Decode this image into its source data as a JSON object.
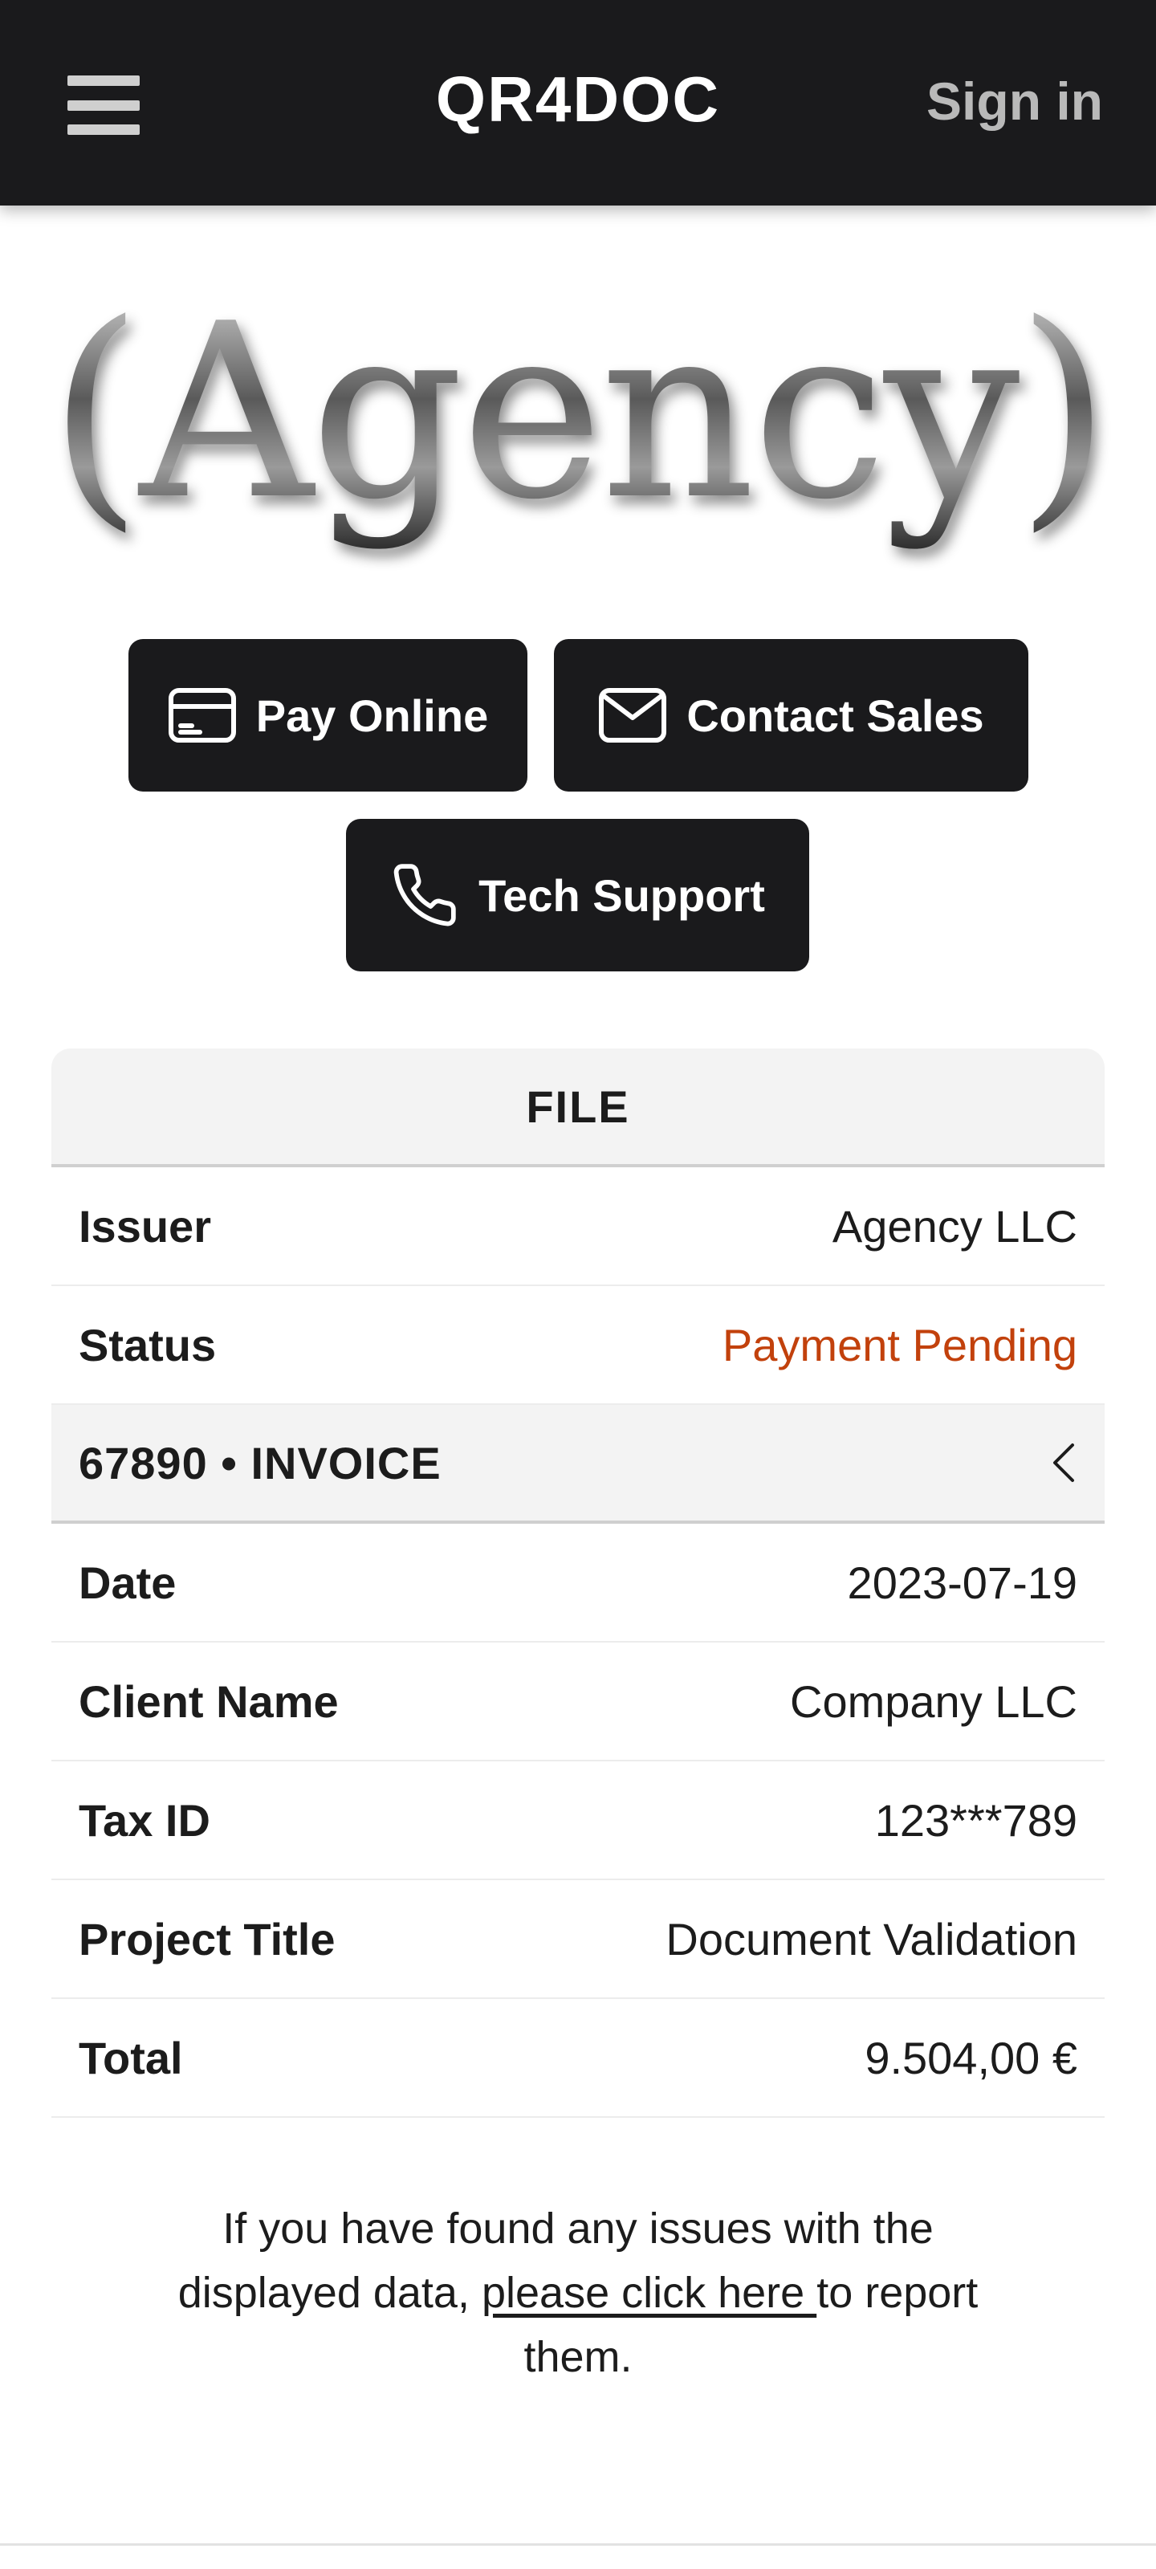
{
  "header": {
    "brand": "QR4DOC",
    "sign_in": "Sign in",
    "menu_icon": "hamburger-menu-icon"
  },
  "logo": {
    "text": "(Agency)"
  },
  "actions": {
    "pay_online": "Pay Online",
    "contact_sales": "Contact Sales",
    "tech_support": "Tech Support",
    "icons": [
      "credit-card-icon",
      "mail-icon",
      "phone-icon"
    ]
  },
  "file": {
    "heading": "FILE",
    "rows": [
      {
        "label": "Issuer",
        "value": "Agency LLC"
      },
      {
        "label": "Status",
        "value": "Payment Pending"
      }
    ],
    "status_color": "#c2410c"
  },
  "invoice": {
    "heading": "67890 • INVOICE",
    "rows": [
      {
        "label": "Date",
        "value": "2023-07-19"
      },
      {
        "label": "Client Name",
        "value": "Company LLC"
      },
      {
        "label": "Tax ID",
        "value": "123***789"
      },
      {
        "label": "Project Title",
        "value": "Document Validation"
      },
      {
        "label": "Total",
        "value": "9.504,00 €"
      }
    ]
  },
  "note": {
    "before": "If you have found any issues with the displayed data, ",
    "link": "please click here ",
    "after": "to report them."
  }
}
